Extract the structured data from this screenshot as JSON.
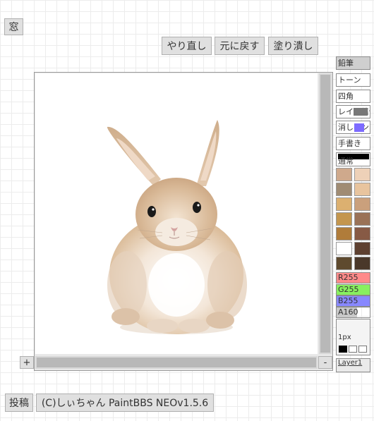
{
  "window_button": "窓",
  "toolbar": {
    "redo": "やり直し",
    "undo": "元に戻す",
    "fill": "塗り潰し"
  },
  "tools": [
    "鉛筆",
    "トーン",
    "四角",
    "レイヤ結合",
    "消しペン",
    "手書き",
    "通常"
  ],
  "palette": [
    [
      "#cfa98c",
      "#eed1b8"
    ],
    [
      "#a08c74",
      "#e8c49e"
    ],
    [
      "#dcb070",
      "#caa07c"
    ],
    [
      "#c4964e",
      "#9a7257"
    ],
    [
      "#b07c3a",
      "#875a45"
    ],
    [
      "#ffffff",
      "#5e4030"
    ],
    [
      "#5e4a2e",
      "#4a382a"
    ]
  ],
  "sliders": {
    "r": {
      "label": "R255",
      "value": 1.0,
      "color": "#ff8a8a"
    },
    "g": {
      "label": "G255",
      "value": 1.0,
      "color": "#88f060"
    },
    "b": {
      "label": "B255",
      "value": 1.0,
      "color": "#8888ff"
    },
    "a": {
      "label": "A160",
      "value": 0.627,
      "color": "#c8c8c8"
    }
  },
  "pen_size": "1px",
  "layer": "Layer1",
  "zoom_in": "+",
  "zoom_out": "-",
  "bottom": {
    "post": "投稿",
    "credit": "(C)しぃちゃん PaintBBS NEOv1.5.6"
  }
}
